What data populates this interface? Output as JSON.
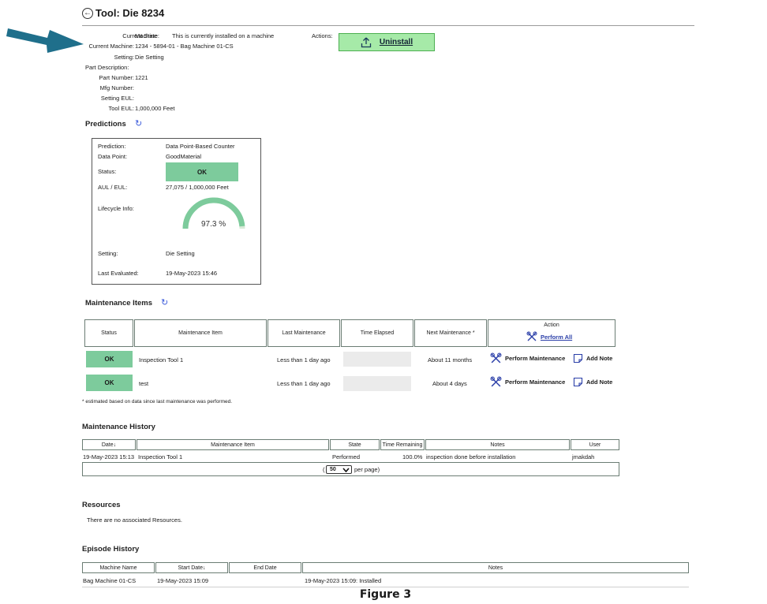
{
  "header": {
    "title": "Tool: Die 8234"
  },
  "details": {
    "current_state_label": "Current State:",
    "current_state_value": "Machine",
    "installed_note": "This is currently installed on a machine",
    "current_machine_label": "Current Machine:",
    "current_machine_value": "1234 - 5894-01 - Bag Machine 01-CS",
    "setting_label": "Setting:",
    "setting_value": "Die Setting",
    "part_description_label": "Part Description:",
    "part_number_label": "Part Number:",
    "part_number_value": "1221",
    "mfg_number_label": "Mfg Number:",
    "setting_eul_label": "Setting EUL:",
    "tool_eul_label": "Tool EUL:",
    "tool_eul_value": "1,000,000 Feet"
  },
  "actions": {
    "label": "Actions:",
    "uninstall_label": "Uninstall"
  },
  "predictions": {
    "title": "Predictions",
    "prediction_label": "Prediction:",
    "prediction_value": "Data Point-Based Counter",
    "data_point_label": "Data Point:",
    "data_point_value": "GoodMaterial",
    "status_label": "Status:",
    "status_value": "OK",
    "aul_label": "AUL / EUL:",
    "aul_value": "27,075 / 1,000,000 Feet",
    "lifecycle_label": "Lifecycle Info:",
    "lifecycle_percent_text": "97.3 %",
    "lifecycle_fraction": 0.973,
    "setting_label": "Setting:",
    "setting_value": "Die Setting",
    "last_evaluated_label": "Last Evaluated:",
    "last_evaluated_value": "19-May-2023 15:46"
  },
  "maintenance": {
    "title": "Maintenance Items",
    "headers": {
      "status": "Status",
      "item": "Maintenance Item",
      "last": "Last Maintenance",
      "elapsed": "Time Elapsed",
      "next": "Next Maintenance *",
      "action": "Action"
    },
    "perform_all_label": "Perform All",
    "rows": [
      {
        "status": "OK",
        "item": "Inspection Tool 1",
        "last": "Less than 1 day ago",
        "next": "About 11 months",
        "perform": "Perform Maintenance",
        "note": "Add Note"
      },
      {
        "status": "OK",
        "item": "test",
        "last": "Less than 1 day ago",
        "next": "About 4 days",
        "perform": "Perform Maintenance",
        "note": "Add Note"
      }
    ],
    "footnote": "* estimated based on data since last maintenance was performed."
  },
  "history": {
    "title": "Maintenance History",
    "headers": {
      "date": "Date↓",
      "item": "Maintenance Item",
      "state": "State",
      "remaining": "Time Remaining",
      "notes": "Notes",
      "user": "User"
    },
    "rows": [
      {
        "date": "19-May-2023 15:13",
        "item": "Inspection Tool 1",
        "state": "Performed",
        "remaining": "100.0%",
        "notes": "inspection done before installation",
        "user": "jmakdah"
      }
    ],
    "pager_prefix": "(",
    "page_size": "50",
    "pager_suffix": "per page)"
  },
  "resources": {
    "title": "Resources",
    "empty_text": "There are no associated Resources."
  },
  "episodes": {
    "title": "Episode History",
    "headers": {
      "machine": "Machine Name",
      "start": "Start Date↓",
      "end": "End Date",
      "notes": "Notes"
    },
    "rows": [
      {
        "machine": "Bag Machine 01-CS",
        "start": "19-May-2023 15:09",
        "end": "",
        "notes": "19-May-2023 15:09: Installed"
      }
    ]
  },
  "caption": "Figure 3",
  "colors": {
    "ok_green": "#7dcb9c",
    "uninstall_bg": "#a6eaa8",
    "arrow": "#1f6f8b",
    "link_blue": "#2b3fa8"
  },
  "icons": [
    "back-arrow-icon",
    "upload-icon",
    "refresh-icon",
    "tools-icon",
    "note-icon",
    "chevron-down-icon",
    "pointer-arrow-icon"
  ]
}
